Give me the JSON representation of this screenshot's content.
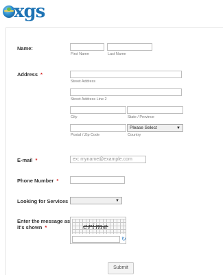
{
  "logo": {
    "text": "xgs"
  },
  "name": {
    "label": "Name:",
    "first_sub": "First Name",
    "last_sub": "Last Name"
  },
  "address": {
    "label": "Address",
    "required_mark": "*",
    "street_sub": "Street Address",
    "street2_sub": "Street Address Line 2",
    "city_sub": "City",
    "state_sub": "State / Province",
    "postal_sub": "Postal / Zip Code",
    "country_sub": "Country",
    "country_selected": "Please Select"
  },
  "email": {
    "label": "E-mail",
    "required_mark": "*",
    "placeholder": "ex: myname@example.com"
  },
  "phone": {
    "label": "Phone Number",
    "required_mark": "*"
  },
  "services": {
    "label": "Looking for Services",
    "selected": ""
  },
  "captcha": {
    "label_line1": "Enter the message as",
    "label_line2": "it's shown",
    "required_mark": "*",
    "word": "crime"
  },
  "submit": {
    "label": "Submit"
  }
}
